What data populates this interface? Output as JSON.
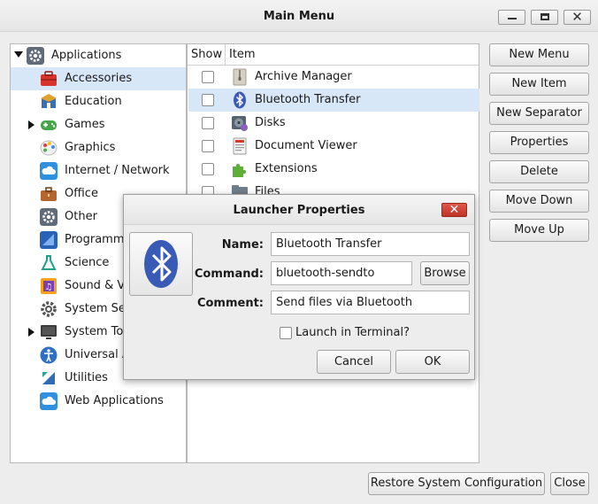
{
  "window": {
    "title": "Main Menu"
  },
  "tree": {
    "root_label": "Applications",
    "items": [
      {
        "label": "Accessories",
        "icon": "toolbox-icon"
      },
      {
        "label": "Education",
        "icon": "education-icon"
      },
      {
        "label": "Games",
        "icon": "gamepad-icon"
      },
      {
        "label": "Graphics",
        "icon": "palette-icon"
      },
      {
        "label": "Internet / Network",
        "icon": "cloud-icon"
      },
      {
        "label": "Office",
        "icon": "briefcase-icon"
      },
      {
        "label": "Other",
        "icon": "gear-icon"
      },
      {
        "label": "Programm",
        "icon": "code-icon"
      },
      {
        "label": "Science",
        "icon": "flask-icon"
      },
      {
        "label": "Sound & V",
        "icon": "music-icon"
      },
      {
        "label": "System Se",
        "icon": "gear-icon"
      },
      {
        "label": "System To",
        "icon": "monitor-icon"
      },
      {
        "label": "Universal A",
        "icon": "accessibility-icon"
      },
      {
        "label": "Utilities",
        "icon": "utilities-icon"
      },
      {
        "label": "Web Applications",
        "icon": "cloud-icon"
      }
    ]
  },
  "items_table": {
    "headers": {
      "show": "Show",
      "item": "Item"
    },
    "rows": [
      {
        "label": "Archive Manager",
        "icon": "archive-icon",
        "checked": false
      },
      {
        "label": "Bluetooth Transfer",
        "icon": "bluetooth-icon",
        "checked": false
      },
      {
        "label": "Disks",
        "icon": "disks-icon",
        "checked": false
      },
      {
        "label": "Document Viewer",
        "icon": "document-icon",
        "checked": false
      },
      {
        "label": "Extensions",
        "icon": "puzzle-icon",
        "checked": false
      },
      {
        "label": "Files",
        "icon": "folder-icon",
        "checked": false
      }
    ]
  },
  "buttons": {
    "new_menu": "New Menu",
    "new_item": "New Item",
    "new_separator": "New Separator",
    "properties": "Properties",
    "delete": "Delete",
    "move_down": "Move Down",
    "move_up": "Move Up",
    "restore": "Restore System Configuration",
    "close": "Close"
  },
  "dialog": {
    "title": "Launcher Properties",
    "close_glyph": "✕",
    "name_label": "Name:",
    "name_value": "Bluetooth Transfer",
    "command_label": "Command:",
    "command_value": "bluetooth-sendto",
    "browse": "Browse",
    "comment_label": "Comment:",
    "comment_value": "Send files via Bluetooth",
    "terminal_label": "Launch in Terminal?",
    "terminal_checked": false,
    "cancel": "Cancel",
    "ok": "OK"
  },
  "colors": {
    "selection": "#d8e7f7",
    "bluetooth": "#3a5bb5",
    "close_red": "#cf4336"
  }
}
